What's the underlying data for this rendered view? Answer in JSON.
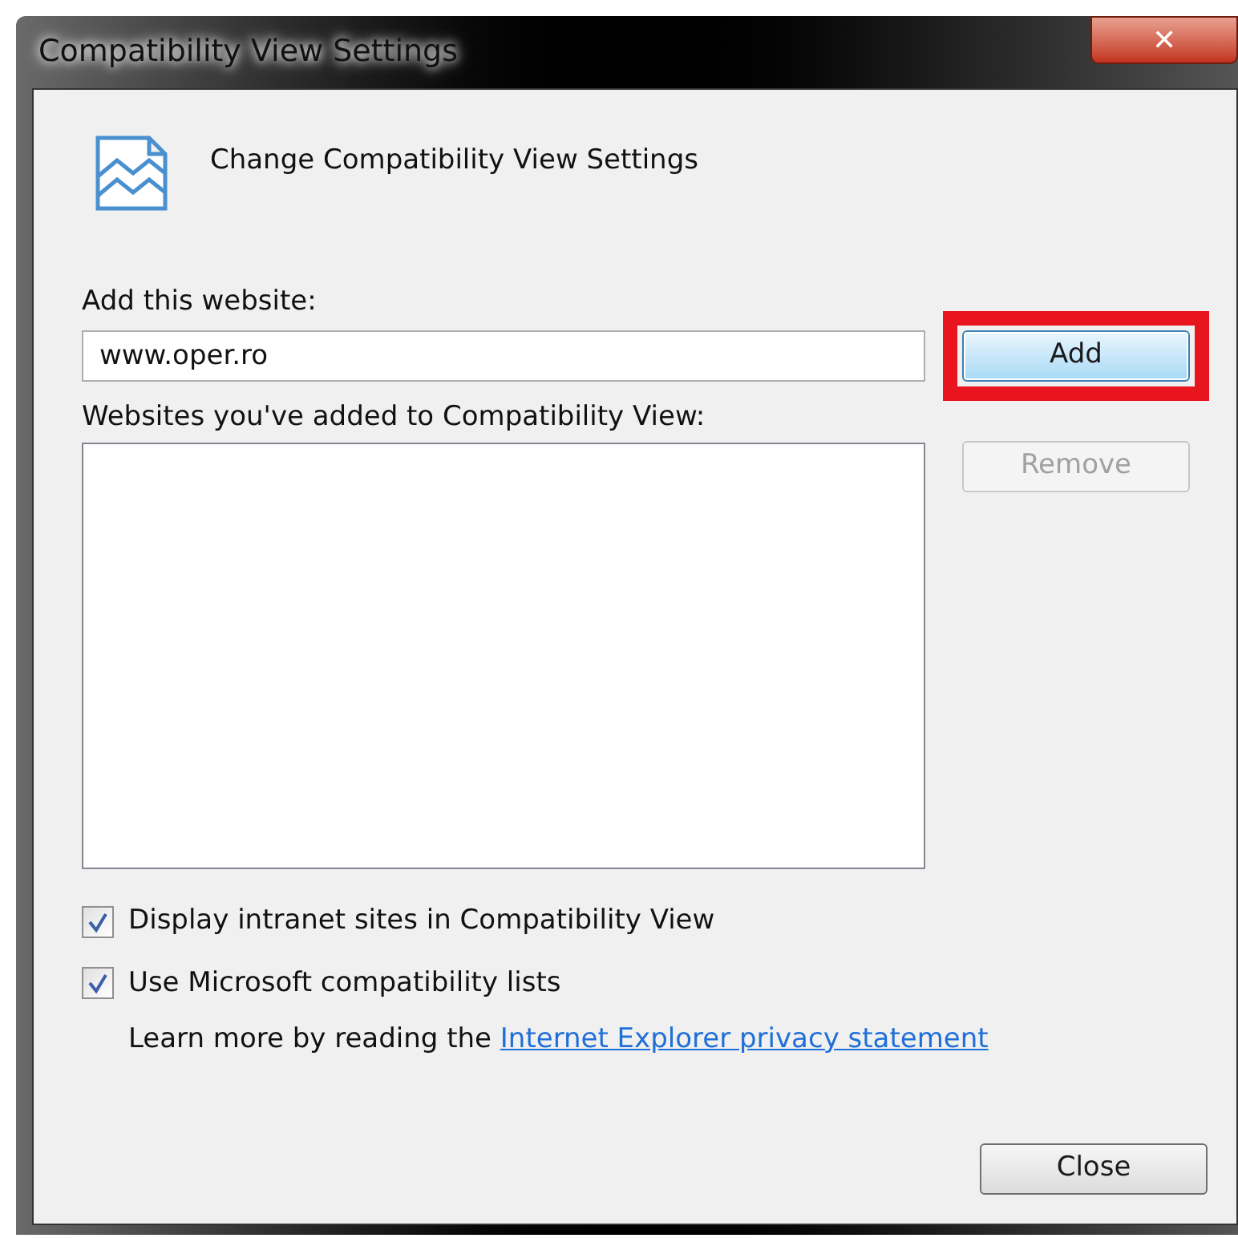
{
  "window": {
    "title": "Compatibility View Settings",
    "close_glyph": "✕"
  },
  "heading": "Change Compatibility View Settings",
  "add_field": {
    "label": "Add this website:",
    "value": "www.oper.ro"
  },
  "add_button": {
    "label": "Add",
    "highlighted": true,
    "disabled": false
  },
  "list": {
    "label": "Websites you've added to Compatibility View:"
  },
  "remove_button": {
    "label": "Remove",
    "disabled": true
  },
  "options": [
    {
      "label": "Display intranet sites in Compatibility View",
      "checked": true
    },
    {
      "label": "Use Microsoft compatibility lists",
      "checked": true
    }
  ],
  "learn_more": {
    "text": "Learn more by reading the",
    "link": "Internet Explorer privacy statement"
  },
  "close_button": {
    "label": "Close"
  }
}
